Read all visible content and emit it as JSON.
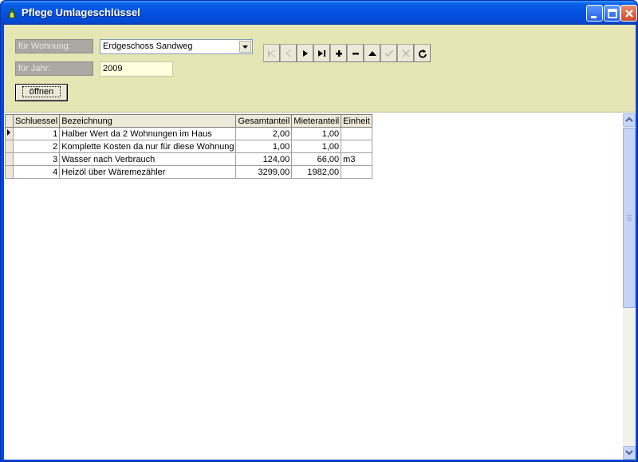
{
  "window": {
    "title": "Pflege Umlageschlüssel"
  },
  "form": {
    "wohnung_label": "für Wohnung:",
    "wohnung_value": "Erdgeschoss Sandweg",
    "jahr_label": "für Jahr:",
    "jahr_value": "2009",
    "open_label": "öffnen"
  },
  "navigator": {
    "buttons": [
      "first",
      "prior",
      "next",
      "last",
      "insert",
      "delete",
      "edit",
      "post",
      "cancel",
      "refresh"
    ]
  },
  "grid": {
    "columns": [
      "Schluessel",
      "Bezeichnung",
      "Gesamtanteil",
      "Mieteranteil",
      "Einheit"
    ],
    "rows": [
      {
        "schluessel": "1",
        "bezeichnung": "Halber Wert da 2 Wohnungen im Haus",
        "gesamt": "2,00",
        "mieter": "1,00",
        "einheit": ""
      },
      {
        "schluessel": "2",
        "bezeichnung": "Komplette Kosten da nur für diese Wohnung",
        "gesamt": "1,00",
        "mieter": "1,00",
        "einheit": ""
      },
      {
        "schluessel": "3",
        "bezeichnung": "Wasser nach Verbrauch",
        "gesamt": "124,00",
        "mieter": "66,00",
        "einheit": "m3"
      },
      {
        "schluessel": "4",
        "bezeichnung": "Heizöl über Wäremezähler",
        "gesamt": "3299,00",
        "mieter": "1982,00",
        "einheit": ""
      }
    ]
  },
  "colors": {
    "panel": "#e6e5b4",
    "titlebar": "#0551e0"
  }
}
